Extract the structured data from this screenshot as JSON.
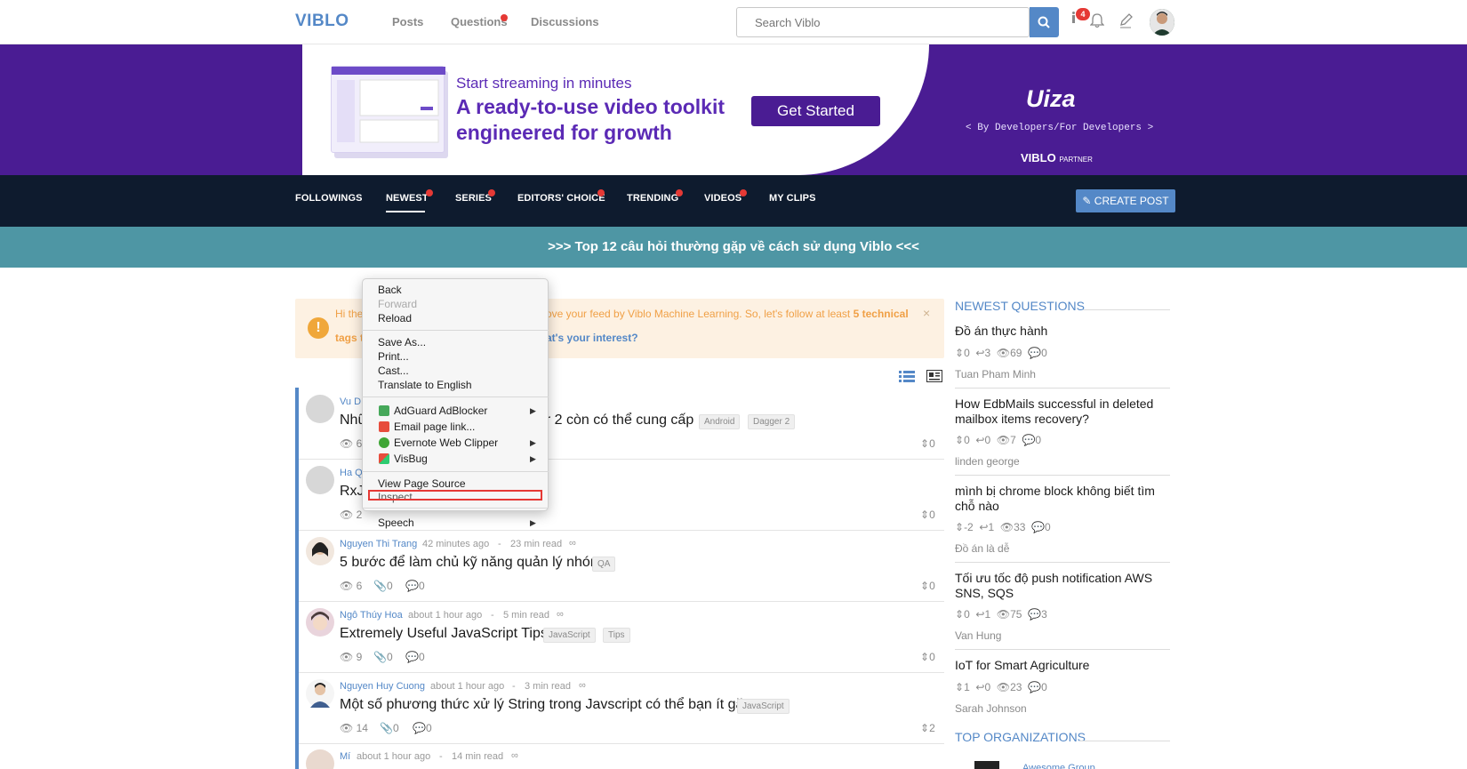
{
  "header": {
    "logo": "VIBLO",
    "nav": [
      "Posts",
      "Questions",
      "Discussions"
    ],
    "search_placeholder": "Search Viblo",
    "notif_count": "4"
  },
  "banner": {
    "small": "Start streaming in minutes",
    "big": "A ready-to-use video toolkit engineered for growth",
    "button": "Get Started",
    "brand": "Uiza",
    "tagline": "< By Developers/For Developers >",
    "partner": "VIBLO",
    "partner_suffix": "PARTNER"
  },
  "tabs": [
    "FOLLOWINGS",
    "NEWEST",
    "SERIES",
    "EDITORS' CHOICE",
    "TRENDING",
    "VIDEOS",
    "MY CLIPS"
  ],
  "create_post": "CREATE POST",
  "announcement": ">>> Top 12 câu hỏi thường gặp về cách sử dụng Viblo <<<",
  "alert": {
    "line1_start": "Hi the",
    "line1_end": "ove your feed by Viblo Machine Learning. So, let's follow at least",
    "line1_bold": "5 technical",
    "line2_start": "tags t",
    "line2_link": "at's your interest?",
    "close": "×"
  },
  "posts": [
    {
      "author": "Vu D",
      "meta": "",
      "title_start": "Nhữ",
      "title_end": "er 2 còn có thể cung cấp",
      "tags": [
        "Android",
        "Dagger 2"
      ],
      "stats": [
        "6"
      ],
      "score": "0"
    },
    {
      "author": "Ha Q",
      "meta": "",
      "title_start": "RxJ",
      "title_end": "",
      "tags": [],
      "stats": [
        "2"
      ],
      "score": "0"
    },
    {
      "author": "Nguyen Thi Trang",
      "time": "42 minutes ago",
      "read": "23 min read",
      "title": "5 bước để làm chủ kỹ năng quản lý nhóm",
      "tags": [
        "QA"
      ],
      "views": "6",
      "clips": "0",
      "comments": "0",
      "score": "0"
    },
    {
      "author": "Ngô Thúy Hoa",
      "time": "about 1 hour ago",
      "read": "5 min read",
      "title": "Extremely Useful JavaScript Tips",
      "tags": [
        "JavaScript",
        "Tips"
      ],
      "views": "9",
      "clips": "0",
      "comments": "0",
      "score": "0"
    },
    {
      "author": "Nguyen Huy Cuong",
      "time": "about 1 hour ago",
      "read": "3 min read",
      "title": "Một số phương thức xử lý String trong Javscript có thể bạn ít gặp",
      "tags": [
        "JavaScript"
      ],
      "views": "14",
      "clips": "0",
      "comments": "0",
      "score": "2"
    },
    {
      "author": "Mí",
      "time": "about 1 hour ago",
      "read": "14 min read"
    }
  ],
  "context_menu": {
    "group1": [
      "Back",
      "Forward",
      "Reload"
    ],
    "group2": [
      "Save As...",
      "Print...",
      "Cast...",
      "Translate to English"
    ],
    "group3": [
      "AdGuard AdBlocker",
      "Email page link...",
      "Evernote Web Clipper",
      "VisBug"
    ],
    "group4": [
      "View Page Source",
      "Inspect"
    ],
    "group5": [
      "Speech"
    ]
  },
  "sidebar": {
    "newest_questions": "NEWEST QUESTIONS",
    "top_orgs": "TOP ORGANIZATIONS",
    "org_peek": "Awesome Group",
    "questions": [
      {
        "title": "Đồ án thực hành",
        "votes": "0",
        "answers": "3",
        "views": "69",
        "comments": "0",
        "author": "Tuan Pham Minh"
      },
      {
        "title": "How EdbMails successful in deleted mailbox items recovery?",
        "votes": "0",
        "answers": "0",
        "views": "7",
        "comments": "0",
        "author": "linden george"
      },
      {
        "title": "mình bị chrome block không biết tìm chỗ nào",
        "votes": "-2",
        "answers": "1",
        "views": "33",
        "comments": "0",
        "author": "Đồ án là dễ"
      },
      {
        "title": "Tối ưu tốc độ push notification AWS SNS, SQS",
        "votes": "0",
        "answers": "1",
        "views": "75",
        "comments": "3",
        "author": "Van Hung"
      },
      {
        "title": "IoT for Smart Agriculture",
        "votes": "1",
        "answers": "0",
        "views": "23",
        "comments": "0",
        "author": "Sarah Johnson"
      }
    ]
  }
}
